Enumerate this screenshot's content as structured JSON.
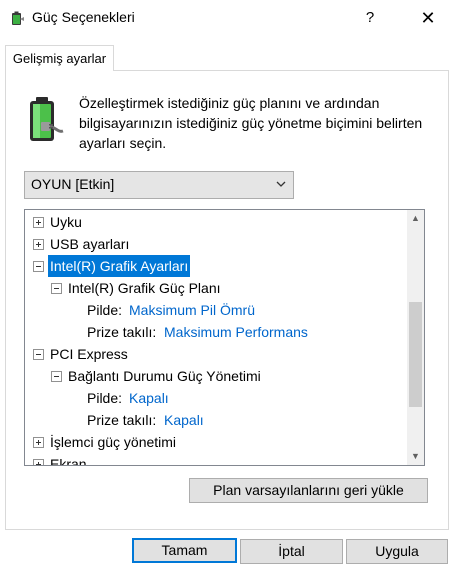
{
  "window": {
    "title": "Güç Seçenekleri",
    "help_label": "?",
    "close_label": "✕"
  },
  "tab": {
    "label": "Gelişmiş ayarlar"
  },
  "intro": {
    "text": "Özelleştirmek istediğiniz güç planını ve ardından bilgisayarınızın istediğiniz güç yönetme biçimini belirten ayarları seçin."
  },
  "plan_select": {
    "value": "OYUN [Etkin]"
  },
  "tree": {
    "uyku": "Uyku",
    "usb": "USB ayarları",
    "intel_graphics": "Intel(R) Grafik Ayarları",
    "intel_plan": "Intel(R) Grafik Güç Planı",
    "intel_plan_battery_label": "Pilde:",
    "intel_plan_battery_value": "Maksimum Pil Ömrü",
    "intel_plan_plugged_label": "Prize takılı:",
    "intel_plan_plugged_value": "Maksimum Performans",
    "pci": "PCI Express",
    "link_state": "Bağlantı Durumu Güç Yönetimi",
    "link_battery_label": "Pilde:",
    "link_battery_value": "Kapalı",
    "link_plugged_label": "Prize takılı:",
    "link_plugged_value": "Kapalı",
    "processor": "İşlemci güç yönetimi",
    "display": "Ekran"
  },
  "buttons": {
    "restore": "Plan varsayılanlarını geri yükle",
    "ok": "Tamam",
    "cancel": "İptal",
    "apply": "Uygula"
  },
  "colors": {
    "accent": "#0078d7",
    "link": "#0066cc"
  }
}
